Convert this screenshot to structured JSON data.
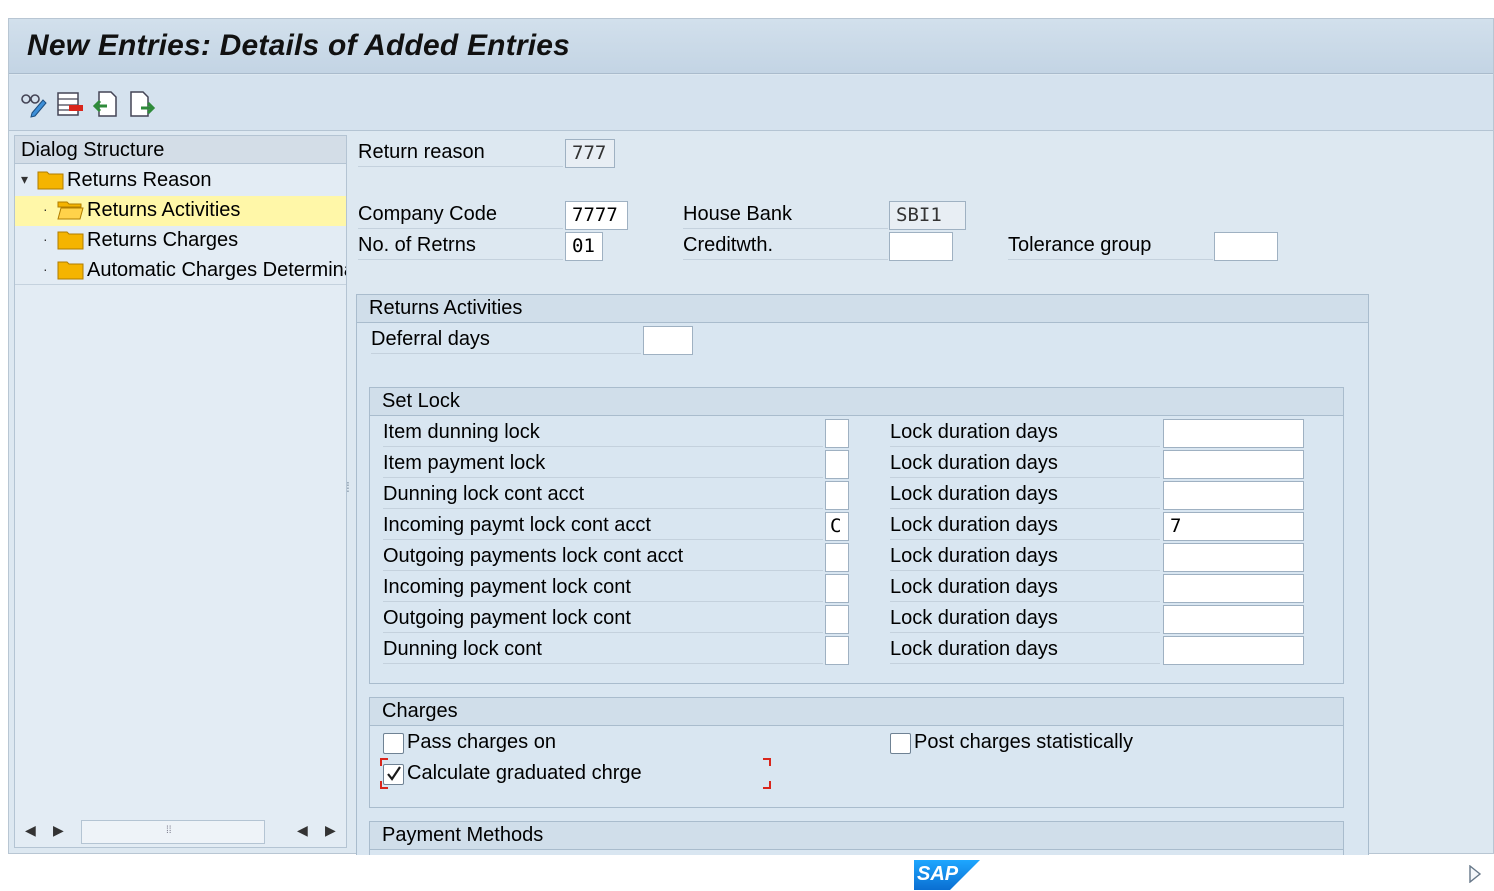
{
  "title": "New Entries: Details of Added Entries",
  "toolbar": {
    "buttons": [
      {
        "icon": "glasses-pencil-icon"
      },
      {
        "icon": "delete-row-icon"
      },
      {
        "icon": "previous-entry-icon"
      },
      {
        "icon": "next-entry-icon"
      }
    ]
  },
  "tree": {
    "header": "Dialog Structure",
    "items": [
      {
        "label": "Returns Reason"
      },
      {
        "label": "Returns Activities",
        "selected": true
      },
      {
        "label": "Returns Charges"
      },
      {
        "label": "Automatic Charges Determina"
      }
    ]
  },
  "form": {
    "return_reason": {
      "label": "Return reason",
      "value": "777"
    },
    "company_code": {
      "label": "Company Code",
      "value": "7777"
    },
    "no_of_retrns": {
      "label": "No. of Retrns",
      "value": "01"
    },
    "house_bank": {
      "label": "House Bank",
      "value": "SBI1"
    },
    "creditwth": {
      "label": "Creditwth.",
      "value": ""
    },
    "tolerance_group": {
      "label": "Tolerance group",
      "value": ""
    }
  },
  "activities": {
    "title": "Returns Activities",
    "deferral_days": {
      "label": "Deferral days",
      "value": ""
    },
    "set_lock": {
      "title": "Set Lock",
      "rows": [
        {
          "label": "Item dunning lock",
          "lock": "",
          "duration_label": "Lock duration days",
          "duration": ""
        },
        {
          "label": "Item payment lock",
          "lock": "",
          "duration_label": "Lock duration days",
          "duration": ""
        },
        {
          "label": "Dunning lock cont acct",
          "lock": "",
          "duration_label": "Lock duration days",
          "duration": ""
        },
        {
          "label": "Incoming paymt lock cont acct",
          "lock": "C",
          "duration_label": "Lock duration days",
          "duration": "7"
        },
        {
          "label": "Outgoing payments lock cont acct",
          "lock": "",
          "duration_label": "Lock duration days",
          "duration": ""
        },
        {
          "label": "Incoming payment lock cont",
          "lock": "",
          "duration_label": "Lock duration days",
          "duration": ""
        },
        {
          "label": "Outgoing payment lock cont",
          "lock": "",
          "duration_label": "Lock duration days",
          "duration": ""
        },
        {
          "label": "Dunning lock cont",
          "lock": "",
          "duration_label": "Lock duration days",
          "duration": ""
        }
      ]
    },
    "charges": {
      "title": "Charges",
      "pass_charges_on": {
        "label": "Pass charges on",
        "checked": false
      },
      "post_charges_statistically": {
        "label": "Post charges statistically",
        "checked": false
      },
      "calculate_graduated": {
        "label": "Calculate graduated chrge",
        "checked": true
      }
    },
    "payment_methods": {
      "title": "Payment Methods"
    }
  },
  "footer": {
    "logo": "SAP"
  },
  "colors": {
    "selected_row": "#fff7a8",
    "folder": "#f5b400",
    "focus": "#d9261c",
    "sap_blue": "#0a6ed1"
  }
}
